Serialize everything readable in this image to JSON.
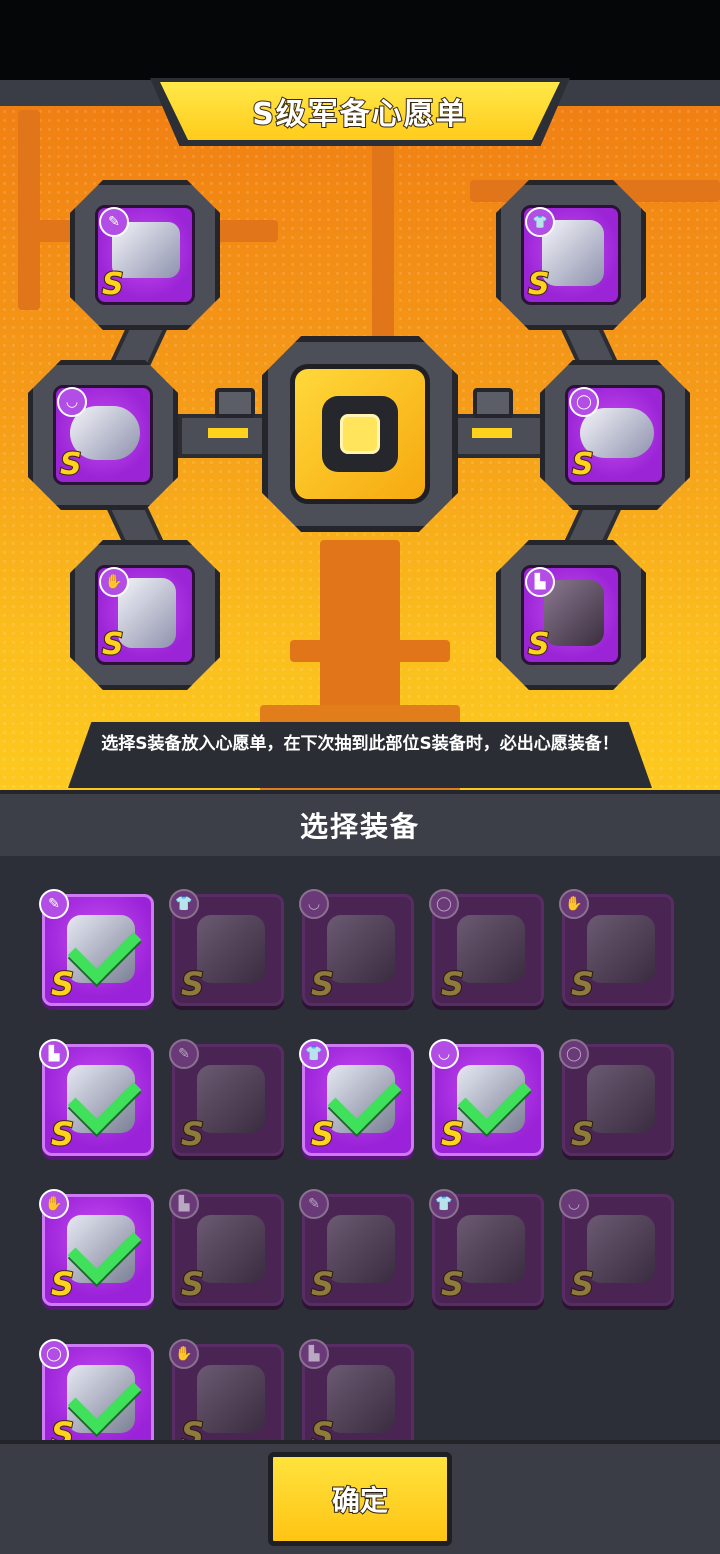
{
  "title": "S级军备心愿单",
  "tip": "选择S装备放入心愿单，在下次抽到此部位S装备时，必出心愿装备！",
  "section_title": "选择装备",
  "confirm_label": "确定",
  "grade_label": "S",
  "wishlist_slots": [
    {
      "name": "weapon-slot",
      "type_icon": "pen-nib-icon",
      "glyph": "✎"
    },
    {
      "name": "armor-slot",
      "type_icon": "shirt-icon",
      "glyph": "👕"
    },
    {
      "name": "necklace-slot",
      "type_icon": "necklace-icon",
      "glyph": "◡"
    },
    {
      "name": "belt-slot",
      "type_icon": "belt-icon",
      "glyph": "◯"
    },
    {
      "name": "glove-slot",
      "type_icon": "glove-icon",
      "glyph": "✋"
    },
    {
      "name": "boots-slot",
      "type_icon": "boot-icon",
      "glyph": "▙"
    }
  ],
  "equipment": [
    {
      "type_icon": "pen-nib-icon",
      "glyph": "✎",
      "active": true,
      "checked": true
    },
    {
      "type_icon": "shirt-icon",
      "glyph": "👕",
      "active": false,
      "checked": false
    },
    {
      "type_icon": "necklace-icon",
      "glyph": "◡",
      "active": false,
      "checked": false
    },
    {
      "type_icon": "belt-icon",
      "glyph": "◯",
      "active": false,
      "checked": false
    },
    {
      "type_icon": "glove-icon",
      "glyph": "✋",
      "active": false,
      "checked": false
    },
    {
      "type_icon": "boot-icon",
      "glyph": "▙",
      "active": true,
      "checked": true
    },
    {
      "type_icon": "pen-nib-icon",
      "glyph": "✎",
      "active": false,
      "checked": false
    },
    {
      "type_icon": "shirt-icon",
      "glyph": "👕",
      "active": true,
      "checked": true
    },
    {
      "type_icon": "necklace-icon",
      "glyph": "◡",
      "active": true,
      "checked": true
    },
    {
      "type_icon": "belt-icon",
      "glyph": "◯",
      "active": false,
      "checked": false
    },
    {
      "type_icon": "glove-icon",
      "glyph": "✋",
      "active": true,
      "checked": true
    },
    {
      "type_icon": "boot-icon",
      "glyph": "▙",
      "active": false,
      "checked": false
    },
    {
      "type_icon": "pen-nib-icon",
      "glyph": "✎",
      "active": false,
      "checked": false
    },
    {
      "type_icon": "shirt-icon",
      "glyph": "👕",
      "active": false,
      "checked": false
    },
    {
      "type_icon": "necklace-icon",
      "glyph": "◡",
      "active": false,
      "checked": false
    },
    {
      "type_icon": "belt-icon",
      "glyph": "◯",
      "active": true,
      "checked": true
    },
    {
      "type_icon": "glove-icon",
      "glyph": "✋",
      "active": false,
      "checked": false
    },
    {
      "type_icon": "boot-icon",
      "glyph": "▙",
      "active": false,
      "checked": false
    }
  ],
  "colors": {
    "accent_yellow": "#ffd21d",
    "rarity_purple": "#a52ae0",
    "check_green": "#3fe05a",
    "hero_orange": "#f59b18"
  }
}
